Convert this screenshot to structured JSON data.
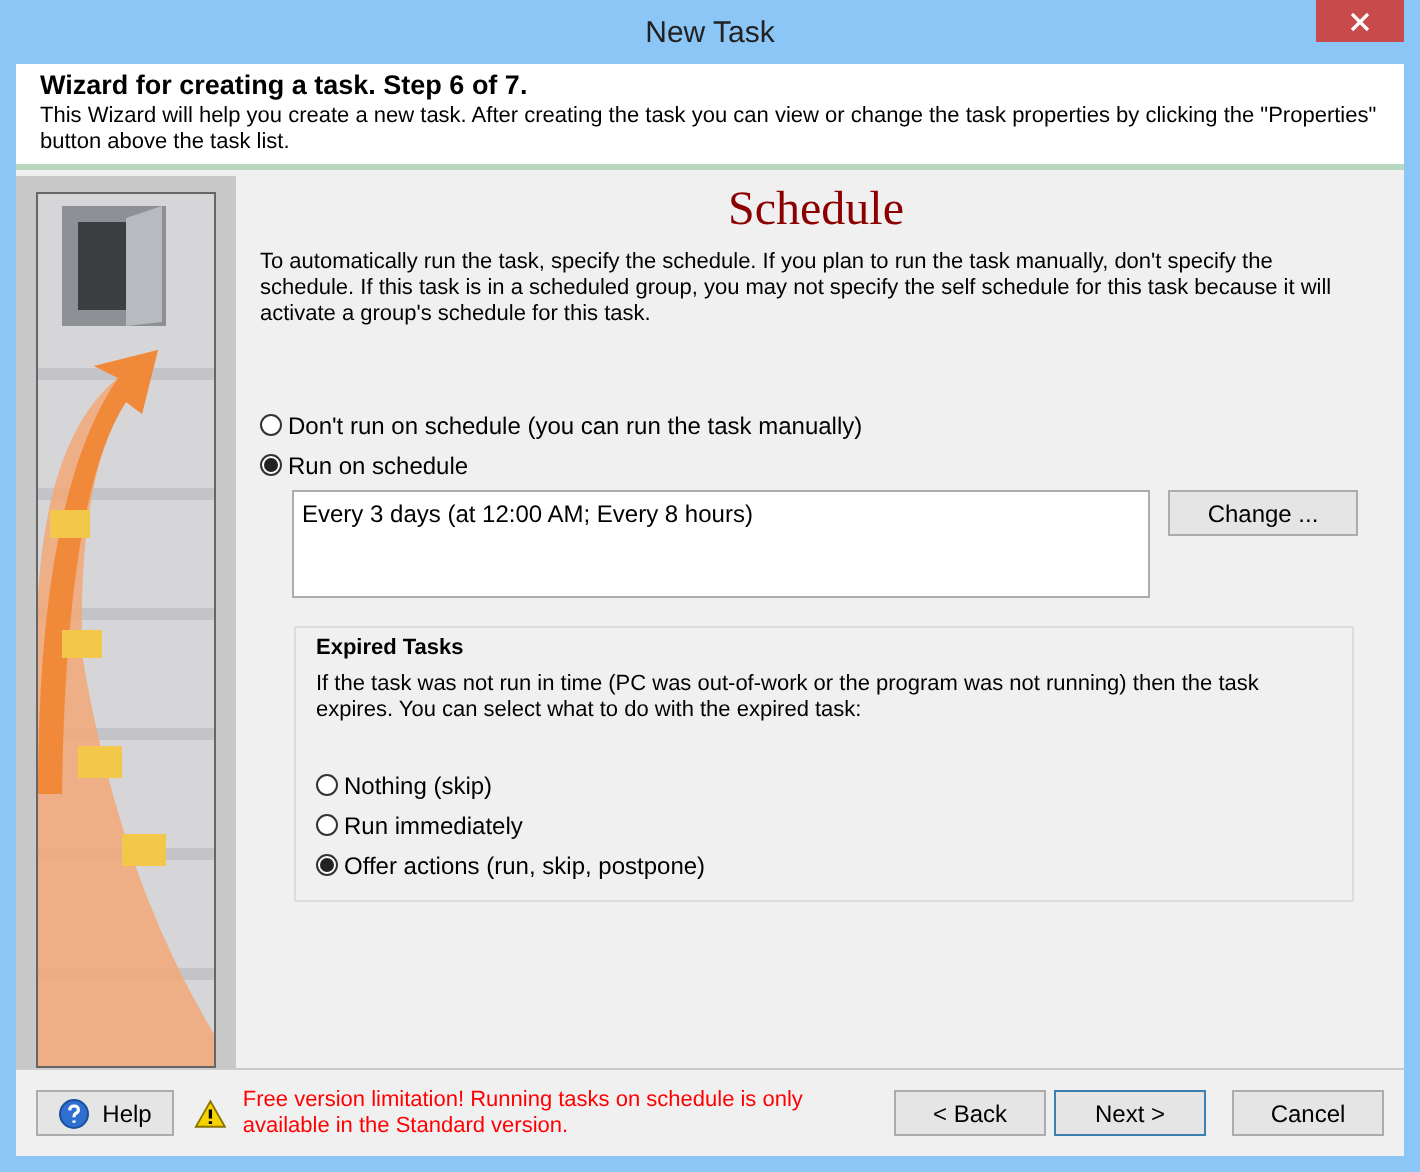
{
  "window": {
    "title": "New Task"
  },
  "header": {
    "title": "Wizard for creating a task. Step 6 of 7.",
    "description": "This Wizard will help you create a new task. After creating the task you can view or change the task properties by clicking the \"Properties\" button above the task list."
  },
  "page": {
    "heading": "Schedule",
    "intro": "To automatically run the task, specify the schedule. If you plan to run the task manually, don't specify the schedule. If this task is in a scheduled group, you may not specify the self schedule for this task because it will activate a group's schedule for this task.",
    "options": [
      {
        "label": "Don't run on schedule (you can run the task manually)",
        "selected": false
      },
      {
        "label": "Run on schedule",
        "selected": true
      }
    ],
    "schedule_text": "Every 3 days (at 12:00 AM; Every 8 hours)",
    "change_button": "Change ...",
    "expired": {
      "title": "Expired Tasks",
      "description": "If the task was not run in time (PC was out-of-work or the program was not running) then the task expires. You can select what to do with the expired task:",
      "options": [
        {
          "label": "Nothing (skip)",
          "selected": false
        },
        {
          "label": "Run immediately",
          "selected": false
        },
        {
          "label": "Offer actions (run, skip, postpone)",
          "selected": true
        }
      ]
    }
  },
  "footer": {
    "help": "Help",
    "warning": "Free version limitation! Running tasks on schedule is only available in the Standard version.",
    "buttons": [
      {
        "label": "< Back",
        "kind": "normal"
      },
      {
        "label": "Next >",
        "kind": "default"
      },
      {
        "label": "Cancel",
        "kind": "normal"
      }
    ]
  }
}
